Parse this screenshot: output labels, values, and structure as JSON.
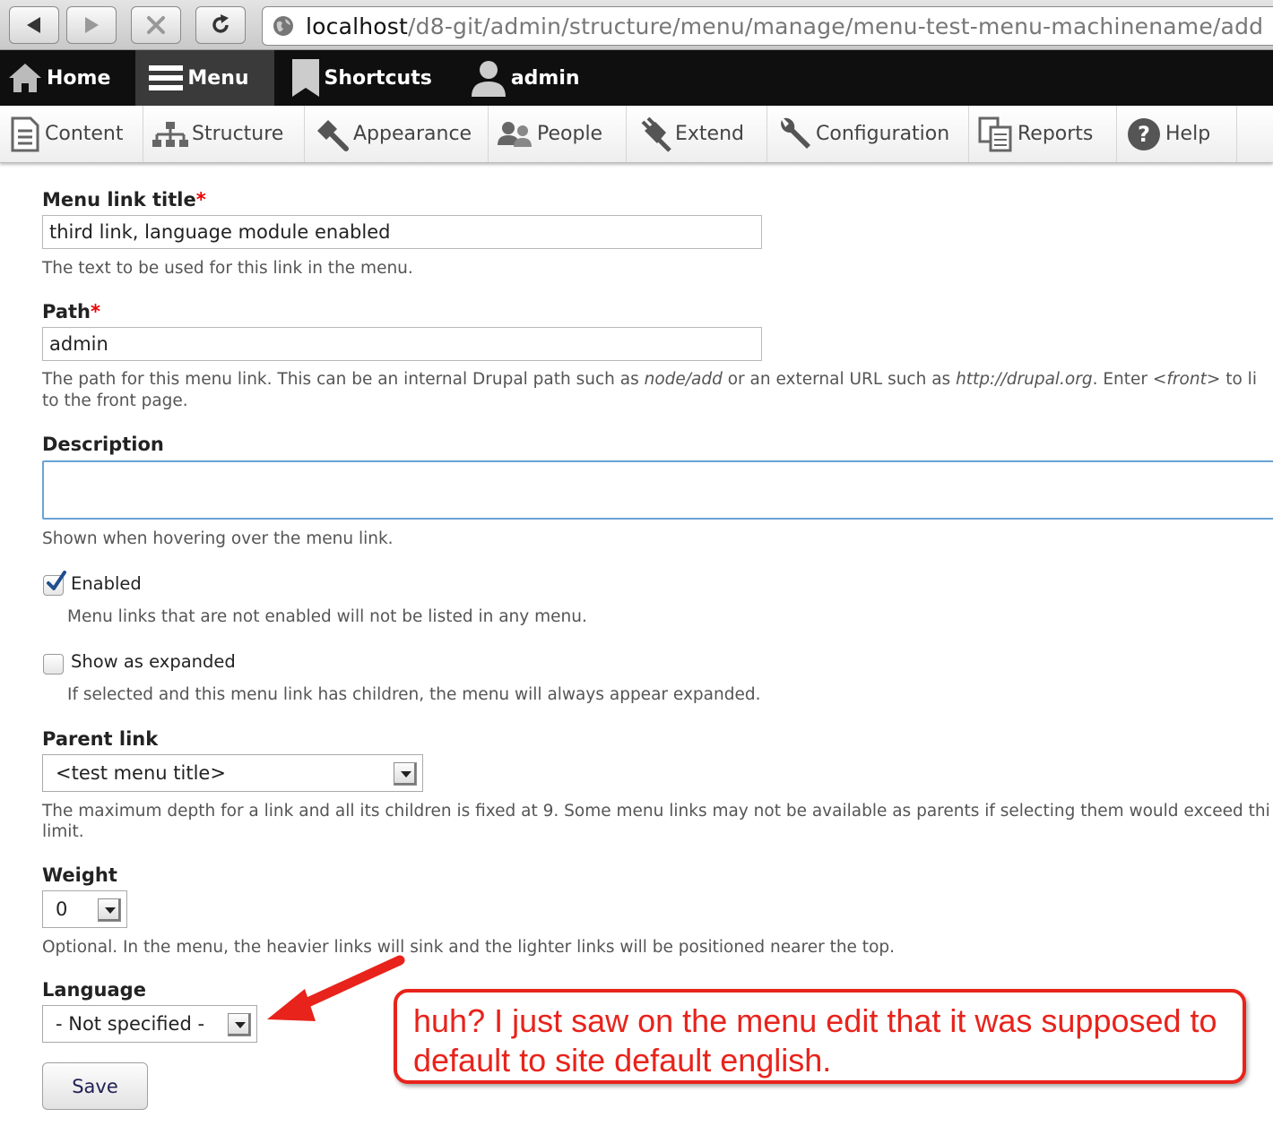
{
  "browser": {
    "url_host": "localhost",
    "url_path": "/d8-git/admin/structure/menu/manage/menu-test-menu-machinename/add"
  },
  "toolbar": {
    "home": "Home",
    "menu": "Menu",
    "shortcuts": "Shortcuts",
    "user": "admin"
  },
  "admin_menu": {
    "content": "Content",
    "structure": "Structure",
    "appearance": "Appearance",
    "people": "People",
    "extend": "Extend",
    "configuration": "Configuration",
    "reports": "Reports",
    "help": "Help"
  },
  "form": {
    "title": {
      "label": "Menu link title",
      "required_mark": "*",
      "value": "third link, language module enabled",
      "description": "The text to be used for this link in the menu."
    },
    "path": {
      "label": "Path",
      "required_mark": "*",
      "value": "admin",
      "desc_a": "The path for this menu link. This can be an internal Drupal path such as ",
      "desc_em1": "node/add",
      "desc_b": " or an external URL such as ",
      "desc_em2": "http://drupal.org",
      "desc_c": ". Enter ",
      "desc_em3": "<front>",
      "desc_d": " to li",
      "desc_line2": "to the front page."
    },
    "description": {
      "label": "Description",
      "value": "",
      "help": "Shown when hovering over the menu link."
    },
    "enabled": {
      "label": "Enabled",
      "checked": true,
      "help": "Menu links that are not enabled will not be listed in any menu."
    },
    "expanded": {
      "label": "Show as expanded",
      "checked": false,
      "help": "If selected and this menu link has children, the menu will always appear expanded."
    },
    "parent": {
      "label": "Parent link",
      "value": "<test menu title>",
      "help_line1": "The maximum depth for a link and all its children is fixed at 9. Some menu links may not be available as parents if selecting them would exceed thi",
      "help_line2": "limit."
    },
    "weight": {
      "label": "Weight",
      "value": "0",
      "help": "Optional. In the menu, the heavier links will sink and the lighter links will be positioned nearer the top."
    },
    "language": {
      "label": "Language",
      "value": "- Not specified -"
    },
    "save": "Save"
  },
  "annotation": {
    "line1": "huh? I just saw on the menu edit that it was supposed to",
    "line2": "default to site default english.",
    "color": "#e8231b"
  }
}
